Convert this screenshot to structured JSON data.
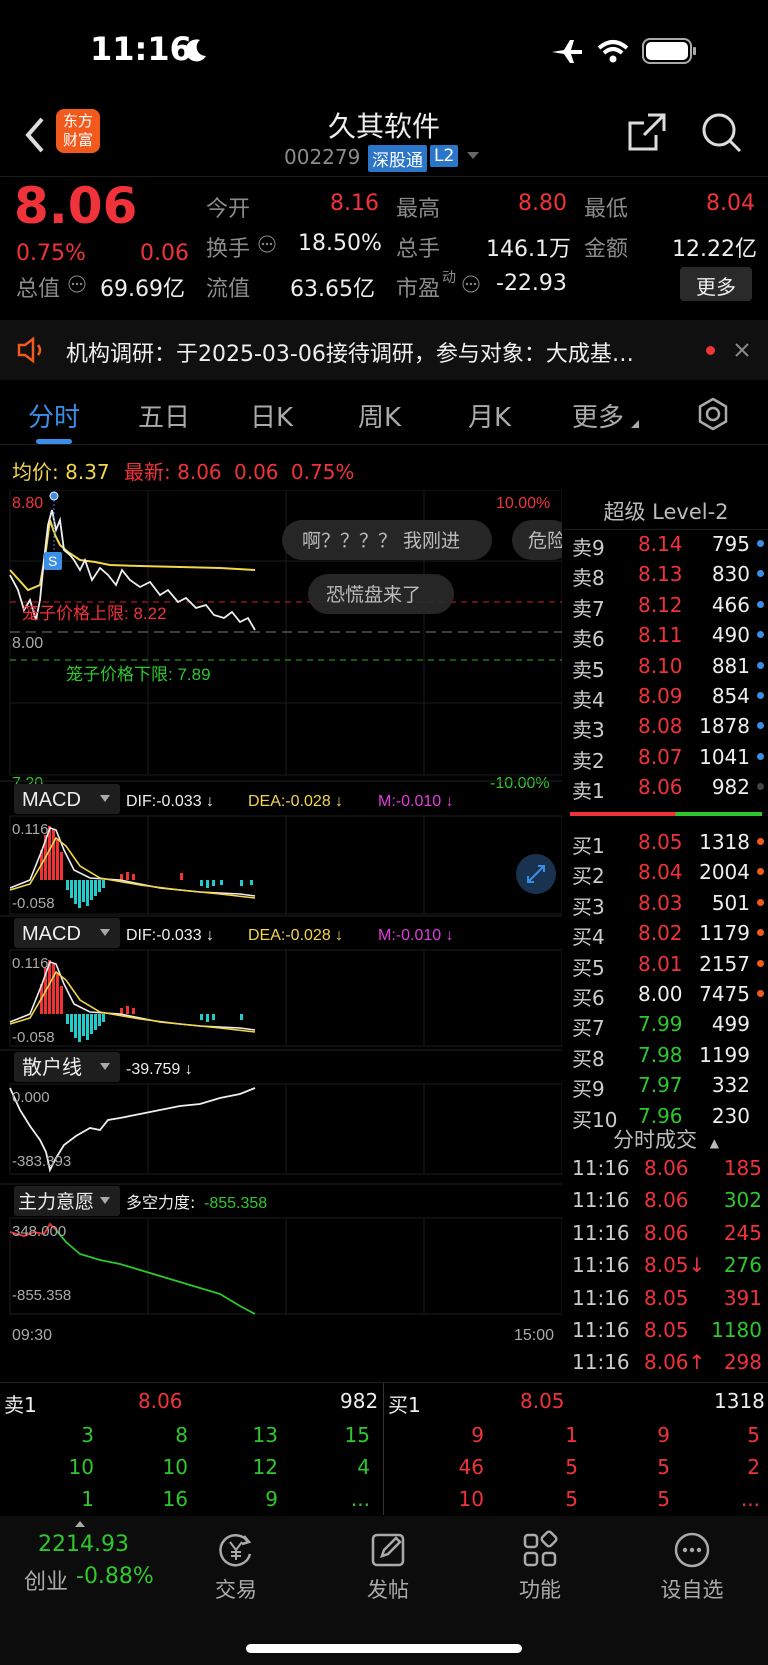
{
  "status_bar": {
    "time": "11:16"
  },
  "header": {
    "stock_name": "久其软件",
    "stock_code": "002279",
    "badge_connect": "深股通",
    "badge_level": "L2",
    "logo_text": "东方财富"
  },
  "quote": {
    "price": "8.06",
    "change_pct": "0.75%",
    "change": "0.06",
    "open_label": "今开",
    "open": "8.16",
    "high_label": "最高",
    "high": "8.80",
    "low_label": "最低",
    "low": "8.04",
    "turnover_label": "换手",
    "turnover": "18.50%",
    "volume_label": "总手",
    "volume": "146.1万",
    "amount_label": "金额",
    "amount": "12.22亿",
    "mktcap_label": "总值",
    "mktcap": "69.69亿",
    "float_label": "流值",
    "float": "63.65亿",
    "pe_label": "市盈",
    "pe_sup": "动",
    "pe": "-22.93",
    "more_button": "更多"
  },
  "notice": {
    "text": "机构调研：于2025-03-06接待调研，参与对象：大成基…"
  },
  "tabs": [
    {
      "label": "分时",
      "active": true
    },
    {
      "label": "五日"
    },
    {
      "label": "日K"
    },
    {
      "label": "周K"
    },
    {
      "label": "月K"
    },
    {
      "label": "更多"
    }
  ],
  "intraday": {
    "avg_label": "均价:",
    "avg": "8.37",
    "latest_label": "最新:",
    "latest": "8.06",
    "latest_change": "0.06",
    "latest_pct": "0.75%",
    "y_top": "8.80",
    "y_mid": "8.00",
    "y_bottom": "7.20",
    "pct_top": "10.00%",
    "pct_bottom": "-10.00%",
    "cage_upper": "笼子价格上限: 8.22",
    "cage_lower": "笼子价格下限: 7.89",
    "danmaku": [
      "啊？？？？ 我刚进",
      "危险",
      "恐慌盘来了"
    ],
    "marker_s": "S"
  },
  "macd1": {
    "name": "MACD",
    "dif": "DIF:-0.033 ↓",
    "dea": "DEA:-0.028 ↓",
    "m": "M:-0.010 ↓",
    "top": "0.116",
    "bottom": "-0.058"
  },
  "macd2": {
    "name": "MACD",
    "dif": "DIF:-0.033 ↓",
    "dea": "DEA:-0.028 ↓",
    "m": "M:-0.010 ↓",
    "top": "0.116",
    "bottom": "-0.058"
  },
  "retail": {
    "name": "散户线",
    "value": "-39.759 ↓",
    "top": "0.000",
    "bottom": "-383.393"
  },
  "main_force": {
    "name": "主力意愿",
    "label": "多空力度:",
    "value": "-855.358",
    "top": "348.000",
    "bottom": "-855.358"
  },
  "time_axis": {
    "start": "09:30",
    "end": "15:00"
  },
  "order_book": {
    "title": "超级 Level-2",
    "asks": [
      {
        "label": "卖9",
        "price": "8.14",
        "vol": "795"
      },
      {
        "label": "卖8",
        "price": "8.13",
        "vol": "830"
      },
      {
        "label": "卖7",
        "price": "8.12",
        "vol": "466"
      },
      {
        "label": "卖6",
        "price": "8.11",
        "vol": "490"
      },
      {
        "label": "卖5",
        "price": "8.10",
        "vol": "881"
      },
      {
        "label": "卖4",
        "price": "8.09",
        "vol": "854"
      },
      {
        "label": "卖3",
        "price": "8.08",
        "vol": "1878"
      },
      {
        "label": "卖2",
        "price": "8.07",
        "vol": "1041"
      },
      {
        "label": "卖1",
        "price": "8.06",
        "vol": "982"
      }
    ],
    "bids": [
      {
        "label": "买1",
        "price": "8.05",
        "vol": "1318"
      },
      {
        "label": "买2",
        "price": "8.04",
        "vol": "2004"
      },
      {
        "label": "买3",
        "price": "8.03",
        "vol": "501"
      },
      {
        "label": "买4",
        "price": "8.02",
        "vol": "1179"
      },
      {
        "label": "买5",
        "price": "8.01",
        "vol": "2157"
      },
      {
        "label": "买6",
        "price": "8.00",
        "vol": "7475"
      },
      {
        "label": "买7",
        "price": "7.99",
        "vol": "499"
      },
      {
        "label": "买8",
        "price": "7.98",
        "vol": "1199"
      },
      {
        "label": "买9",
        "price": "7.97",
        "vol": "332"
      },
      {
        "label": "买10",
        "price": "7.96",
        "vol": "230"
      }
    ]
  },
  "trades": {
    "title": "分时成交",
    "rows": [
      {
        "time": "11:16",
        "price": "8.06",
        "vol": "185"
      },
      {
        "time": "11:16",
        "price": "8.06",
        "vol": "302"
      },
      {
        "time": "11:16",
        "price": "8.06",
        "vol": "245"
      },
      {
        "time": "11:16",
        "price": "8.05↓",
        "vol": "276"
      },
      {
        "time": "11:16",
        "price": "8.05",
        "vol": "391"
      },
      {
        "time": "11:16",
        "price": "8.05",
        "vol": "1180"
      },
      {
        "time": "11:16",
        "price": "8.06↑",
        "vol": "298"
      }
    ]
  },
  "queue": {
    "sell": {
      "label": "卖1",
      "price": "8.06",
      "vol": "982",
      "rows": [
        [
          "3",
          "8",
          "13",
          "15"
        ],
        [
          "10",
          "10",
          "12",
          "4"
        ],
        [
          "1",
          "16",
          "9",
          "..."
        ]
      ]
    },
    "buy": {
      "label": "买1",
      "price": "8.05",
      "vol": "1318",
      "rows": [
        [
          "9",
          "1",
          "9",
          "5"
        ],
        [
          "46",
          "5",
          "5",
          "2"
        ],
        [
          "10",
          "5",
          "5",
          "..."
        ]
      ]
    }
  },
  "bottom_nav": {
    "index_value": "2214.93",
    "index_name": "创业",
    "index_change": "-0.88%",
    "items": [
      {
        "label": "交易",
        "icon": "yuan-refresh-icon"
      },
      {
        "label": "发帖",
        "icon": "edit-icon"
      },
      {
        "label": "功能",
        "icon": "grid-icon"
      },
      {
        "label": "设自选",
        "icon": "more-circle-icon"
      }
    ]
  },
  "colors": {
    "up": "#f0333b",
    "down": "#2ec72e",
    "accent": "#3a8ee6",
    "avg_line": "#f2d64b"
  }
}
